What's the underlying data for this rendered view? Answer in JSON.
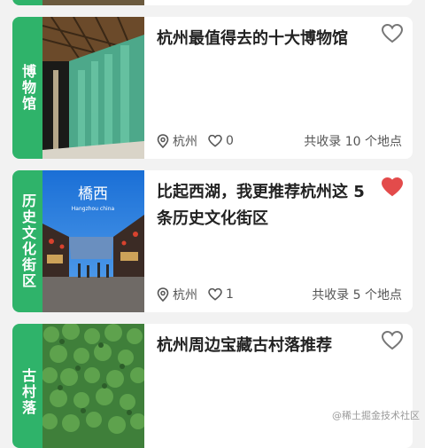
{
  "cards": [
    {},
    {
      "tag": "博物馆",
      "title": "杭州最值得去的十大博物馆",
      "city": "杭州",
      "likes": "0",
      "count": "共收录 10 个地点",
      "favorited": false
    },
    {
      "tag": "历史文化街区",
      "title": "比起西湖，我更推荐杭州这 5 条历史文化街区",
      "city": "杭州",
      "likes": "1",
      "count": "共收录 5 个地点",
      "favorited": true,
      "thumb_text": "橋西",
      "thumb_subtext": "Hangzhou china"
    },
    {
      "tag": "古村落",
      "title": "杭州周边宝藏古村落推荐",
      "favorited": false
    }
  ],
  "watermark": "@稀土掘金技术社区",
  "colors": {
    "accent": "#2fb36a",
    "heart_active": "#e34b4b",
    "heart_inactive": "#777777"
  },
  "icons": {
    "favorite": "heart-icon",
    "city": "location-pin-icon",
    "likes": "heart-outline-icon"
  }
}
